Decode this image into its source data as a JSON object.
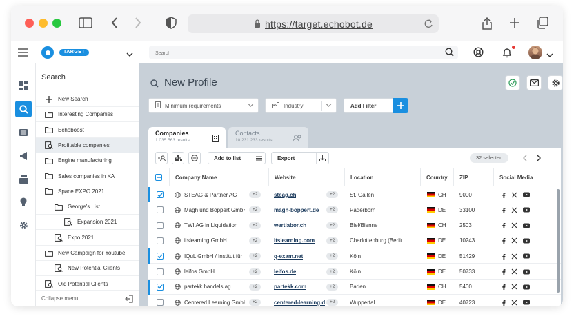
{
  "browser": {
    "url": "https://target.echobot.de"
  },
  "header": {
    "brand": "TARGET",
    "search_placeholder": "Search"
  },
  "colors": {
    "accent": "#1a8fe0",
    "main_bg": "#c8d0d8"
  },
  "sidebar": {
    "title": "Search",
    "items": [
      {
        "label": "New Search",
        "icon": "plus-icon",
        "indent": 0
      },
      {
        "label": "Interesting Companies",
        "icon": "folder-icon",
        "indent": 0
      },
      {
        "label": "Echoboost",
        "icon": "folder-icon",
        "indent": 0
      },
      {
        "label": "Profitable companies",
        "icon": "saved-search-icon",
        "indent": 0,
        "selected": true
      },
      {
        "label": "Engine manufacturing",
        "icon": "folder-icon",
        "indent": 0
      },
      {
        "label": "Sales companies in KA",
        "icon": "folder-icon",
        "indent": 0
      },
      {
        "label": "Space EXPO 2021",
        "icon": "folder-icon",
        "indent": 0
      },
      {
        "label": "George's List",
        "icon": "folder-icon",
        "indent": 1
      },
      {
        "label": "Expansion 2021",
        "icon": "saved-search-icon",
        "indent": 2
      },
      {
        "label": "Expo 2021",
        "icon": "saved-search-icon",
        "indent": 1
      },
      {
        "label": "New Campaign for Youtube",
        "icon": "folder-icon",
        "indent": 0
      },
      {
        "label": "New Potential Clients",
        "icon": "saved-search-icon",
        "indent": 1
      },
      {
        "label": "Old Potential Clients",
        "icon": "saved-search-icon",
        "indent": 0
      }
    ],
    "collapse_label": "Collapse menu"
  },
  "main": {
    "title": "New Profile",
    "filters": {
      "min_req": "Minimum requirements",
      "industry": "Industry",
      "add_filter": "Add Filter"
    },
    "tabs": [
      {
        "label": "Companies",
        "sub": "1.035.563 results"
      },
      {
        "label": "Contacts",
        "sub": "10.231.233 results"
      }
    ],
    "toolbar": {
      "add_to_list": "Add to list",
      "export": "Export",
      "selected": "32 selected"
    },
    "columns": [
      "Company Name",
      "Website",
      "Location",
      "Country",
      "ZIP",
      "Social Media"
    ],
    "rows": [
      {
        "checked": true,
        "name": "STEAG & Partner AG",
        "more": "+2",
        "website": "steag.ch",
        "wmore": "+2",
        "location": "St. Gallen",
        "country": "CH",
        "zip": "9000"
      },
      {
        "checked": false,
        "name": "Magh und Boppert GmbH",
        "more": "+2",
        "website": "magh-boppert.de",
        "wmore": "+2",
        "location": "Paderborn",
        "country": "DE",
        "zip": "33100"
      },
      {
        "checked": false,
        "name": "TWI AG in Liquidation",
        "more": "+2",
        "website": "wertlabor.ch",
        "wmore": "+2",
        "location": "Biel/Bienne",
        "country": "CH",
        "zip": "2503"
      },
      {
        "checked": false,
        "name": "itslearning GmbH",
        "more": "+2",
        "website": "itslearning.com",
        "wmore": "+2",
        "location": "Charlottenburg (Berlin)",
        "country": "DE",
        "zip": "10243"
      },
      {
        "checked": true,
        "name": "IQuL GmbH / Institut für",
        "more": "+2",
        "website": "q-exam.net",
        "wmore": "+2",
        "location": "Köln",
        "country": "DE",
        "zip": "51429"
      },
      {
        "checked": false,
        "name": "leifos GmbH",
        "more": "+2",
        "website": "leifos.de",
        "wmore": "+2",
        "location": "Köln",
        "country": "DE",
        "zip": "50733"
      },
      {
        "checked": true,
        "name": "partekk handels ag",
        "more": "+2",
        "website": "partekk.com",
        "wmore": "+2",
        "location": "Baden",
        "country": "CH",
        "zip": "5400"
      },
      {
        "checked": false,
        "name": "Centered Learning GmbH",
        "more": "+2",
        "website": "centered-learning.de",
        "wmore": "+2",
        "location": "Wuppertal",
        "country": "DE",
        "zip": "40723"
      }
    ]
  }
}
